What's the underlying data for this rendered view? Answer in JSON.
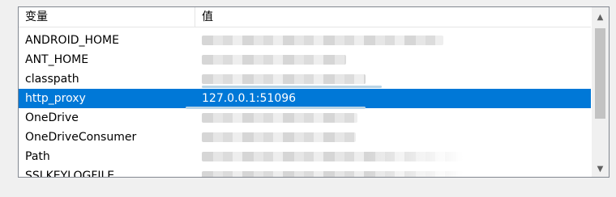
{
  "table": {
    "columns": {
      "variable": "变量",
      "value": "值"
    },
    "rows": [
      {
        "name": "ANDROID_HOME",
        "value": ""
      },
      {
        "name": "ANT_HOME",
        "value": ""
      },
      {
        "name": "classpath",
        "value": ""
      },
      {
        "name": "http_proxy",
        "value": "127.0.0.1:51096",
        "selected": true
      },
      {
        "name": "OneDrive",
        "value": ""
      },
      {
        "name": "OneDriveConsumer",
        "value": ""
      },
      {
        "name": "Path",
        "value": ""
      },
      {
        "name": "SSLKEYLOGFILE",
        "value": ""
      }
    ]
  },
  "colors": {
    "selection": "#0078d7",
    "border": "#828790"
  },
  "scrollbar": {
    "up_icon": "chevron-up-icon",
    "down_icon": "chevron-down-icon"
  }
}
